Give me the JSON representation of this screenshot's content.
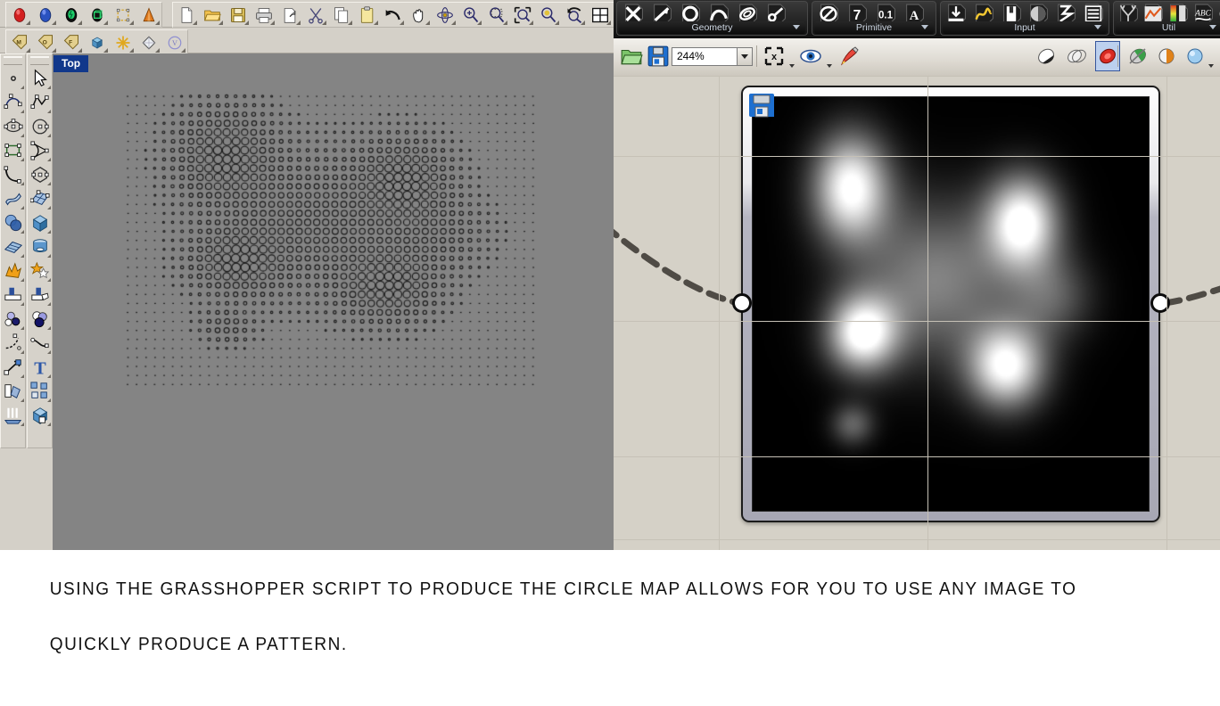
{
  "rhino": {
    "viewport_label": "Top",
    "toolbar_row1": [
      {
        "name": "egg-red-icon",
        "label": "Surface from Network"
      },
      {
        "name": "egg-blue-icon",
        "label": "Surface Tools"
      },
      {
        "name": "egg-green-icon",
        "label": "Solid Tools"
      },
      {
        "name": "box-green-icon",
        "label": "Mesh Tools"
      },
      {
        "name": "cage-yellow-icon",
        "label": "Cage Edit"
      },
      {
        "name": "cone-orange-icon",
        "label": "Render Tools"
      },
      {
        "name": "new-file-icon",
        "label": "New"
      },
      {
        "name": "open-folder-icon",
        "label": "Open"
      },
      {
        "name": "save-disk-icon",
        "label": "Save"
      },
      {
        "name": "print-icon",
        "label": "Print"
      },
      {
        "name": "export-icon",
        "label": "Export"
      },
      {
        "name": "cut-scissors-icon",
        "label": "Cut"
      },
      {
        "name": "copy-icon",
        "label": "Copy"
      },
      {
        "name": "paste-clipboard-icon",
        "label": "Paste"
      },
      {
        "name": "undo-arrow-icon",
        "label": "Undo"
      },
      {
        "name": "pan-hand-icon",
        "label": "Pan"
      },
      {
        "name": "rotate-view-icon",
        "label": "Rotate View"
      },
      {
        "name": "zoom-in-out-icon",
        "label": "Zoom"
      },
      {
        "name": "zoom-window-icon",
        "label": "Zoom Window"
      },
      {
        "name": "zoom-extents-icon",
        "label": "Zoom Extents"
      },
      {
        "name": "zoom-selected-icon",
        "label": "Zoom Selected"
      },
      {
        "name": "zoom-previous-icon",
        "label": "Zoom Previous"
      },
      {
        "name": "four-view-icon",
        "label": "4 Viewports"
      },
      {
        "name": "car-red-icon",
        "label": "Render"
      }
    ],
    "toolbar_row2": [
      {
        "name": "tag-m-icon",
        "label": "Named Views"
      },
      {
        "name": "tag-o-icon",
        "label": "Named Objects"
      },
      {
        "name": "tag-f-icon",
        "label": "Named Filters"
      },
      {
        "name": "cube-blue-icon",
        "label": "Block"
      },
      {
        "name": "snap-star-icon",
        "label": "Osnap"
      },
      {
        "name": "diamond-icon",
        "label": "Surface"
      },
      {
        "name": "circle-v-icon",
        "label": "Visibility"
      }
    ],
    "left_toolbar_col1": [
      {
        "name": "point-icon",
        "label": "Point"
      },
      {
        "name": "curve-control-icon",
        "label": "Control Point Curve"
      },
      {
        "name": "circle-center-icon",
        "label": "Circle"
      },
      {
        "name": "rectangle-icon",
        "label": "Rectangle"
      },
      {
        "name": "arc-icon",
        "label": "Arc"
      },
      {
        "name": "surface-loft-icon",
        "label": "Loft"
      },
      {
        "name": "sphere-boolean-icon",
        "label": "Boolean Union"
      },
      {
        "name": "surface-grid-icon",
        "label": "Surface from Points"
      },
      {
        "name": "explode-icon",
        "label": "Explode"
      },
      {
        "name": "trim-icon",
        "label": "Trim"
      },
      {
        "name": "circles-fill-icon",
        "label": "Fill Hole"
      },
      {
        "name": "fillet-curve-icon",
        "label": "Fillet Curve"
      },
      {
        "name": "move-arrow-icon",
        "label": "Move"
      },
      {
        "name": "offset-icon",
        "label": "Offset"
      },
      {
        "name": "extrude-icon",
        "label": "Extrude"
      }
    ],
    "left_toolbar_col2": [
      {
        "name": "select-arrow-icon",
        "label": "Select"
      },
      {
        "name": "polyline-icon",
        "label": "Polyline"
      },
      {
        "name": "circle-diameter-icon",
        "label": "Circle Diameter"
      },
      {
        "name": "triangle-curve-icon",
        "label": "Curve Tools"
      },
      {
        "name": "polygon-icon",
        "label": "Polygon"
      },
      {
        "name": "surface-patch-icon",
        "label": "Patch Surface"
      },
      {
        "name": "box-solid-icon",
        "label": "Box"
      },
      {
        "name": "cylinder-icon",
        "label": "Cylinder"
      },
      {
        "name": "star-shapes-icon",
        "label": "Boolean Difference"
      },
      {
        "name": "split-icon",
        "label": "Split"
      },
      {
        "name": "circles-overlap-icon",
        "label": "Intersect"
      },
      {
        "name": "blend-curve-icon",
        "label": "Blend Curve"
      },
      {
        "name": "text-tool-icon",
        "label": "Text"
      },
      {
        "name": "array-icon",
        "label": "Array"
      },
      {
        "name": "box-corner-icon",
        "label": "Box Edit"
      }
    ]
  },
  "grasshopper": {
    "ribbon_groups": [
      {
        "tab": "Geometry",
        "icons": [
          {
            "name": "gh-point-icon"
          },
          {
            "name": "gh-vector-icon"
          },
          {
            "name": "gh-circle-icon"
          },
          {
            "name": "gh-curve-icon"
          },
          {
            "name": "gh-surface-icon"
          },
          {
            "name": "gh-mesh-icon"
          }
        ]
      },
      {
        "tab": "Primitive",
        "icons": [
          {
            "name": "gh-boolean-icon"
          },
          {
            "name": "gh-integer-icon"
          },
          {
            "name": "gh-number-icon"
          },
          {
            "name": "gh-text-icon"
          }
        ]
      },
      {
        "tab": "Input",
        "icons": [
          {
            "name": "gh-slider-icon"
          },
          {
            "name": "gh-graph-mapper-icon"
          },
          {
            "name": "gh-button-icon"
          },
          {
            "name": "gh-knob-icon"
          },
          {
            "name": "gh-path-icon"
          },
          {
            "name": "gh-panel-icon"
          }
        ]
      },
      {
        "tab": "Util",
        "icons": [
          {
            "name": "gh-tree-icon"
          },
          {
            "name": "gh-chart-icon"
          },
          {
            "name": "gh-gradient-icon"
          },
          {
            "name": "gh-abc-icon"
          },
          {
            "name": "gh-camera-icon"
          }
        ]
      }
    ],
    "toolbar": {
      "open_label": "Open Document",
      "save_label": "Save Document",
      "zoom_value": "244%",
      "zoom_placeholder": "244%",
      "sketch_label": "Sketch Tool",
      "preview_label": "Preview",
      "bake_label": "Bake",
      "display_modes": [
        {
          "name": "gh-wireframe-preview-icon",
          "active": false
        },
        {
          "name": "gh-shaded-preview-icon",
          "active": false
        },
        {
          "name": "gh-preview-on-icon",
          "active": true
        }
      ],
      "render_modes": [
        {
          "name": "gh-preview-off-icon",
          "active": false
        },
        {
          "name": "gh-preview-half-icon",
          "active": false
        },
        {
          "name": "gh-preview-sphere-icon",
          "active": false
        }
      ]
    },
    "image_component": {
      "name": "image-sampler-preview",
      "save_icon": "floppy-save-icon",
      "input_port_label": "input",
      "output_port_label": "output",
      "resize_grip_label": "resize-grip"
    }
  },
  "caption": {
    "line1": "USING THE GRASSHOPPER SCRIPT TO PRODUCE THE CIRCLE MAP ALLOWS FOR YOU TO USE ANY IMAGE TO",
    "line2": "QUICKLY PRODUCE A PATTERN."
  },
  "chart_data": {
    "type": "heatmap",
    "title": "Circle map radius grid derived from image luminance",
    "xlabel": "",
    "ylabel": "",
    "grid_cols": 46,
    "grid_rows": 33,
    "cell_spacing_px": 10.1,
    "radius_range_px": [
      0.5,
      4.8
    ],
    "blobs": [
      {
        "cx": 0.245,
        "cy": 0.215,
        "rx": 0.115,
        "ry": 0.155,
        "peak": 1.0
      },
      {
        "cx": 0.68,
        "cy": 0.3,
        "rx": 0.11,
        "ry": 0.135,
        "peak": 1.0
      },
      {
        "cx": 0.275,
        "cy": 0.57,
        "rx": 0.105,
        "ry": 0.11,
        "peak": 0.98
      },
      {
        "cx": 0.64,
        "cy": 0.65,
        "rx": 0.115,
        "ry": 0.12,
        "peak": 0.97
      },
      {
        "cx": 0.25,
        "cy": 0.79,
        "rx": 0.065,
        "ry": 0.06,
        "peak": 0.42
      },
      {
        "cx": 0.46,
        "cy": 0.44,
        "rx": 0.24,
        "ry": 0.23,
        "peak": 0.55
      },
      {
        "cx": 0.76,
        "cy": 0.48,
        "rx": 0.12,
        "ry": 0.12,
        "peak": 0.35
      }
    ],
    "background_value": 0.0,
    "colormap": "grayscale-black-to-white",
    "legend": "none",
    "grid": false
  }
}
